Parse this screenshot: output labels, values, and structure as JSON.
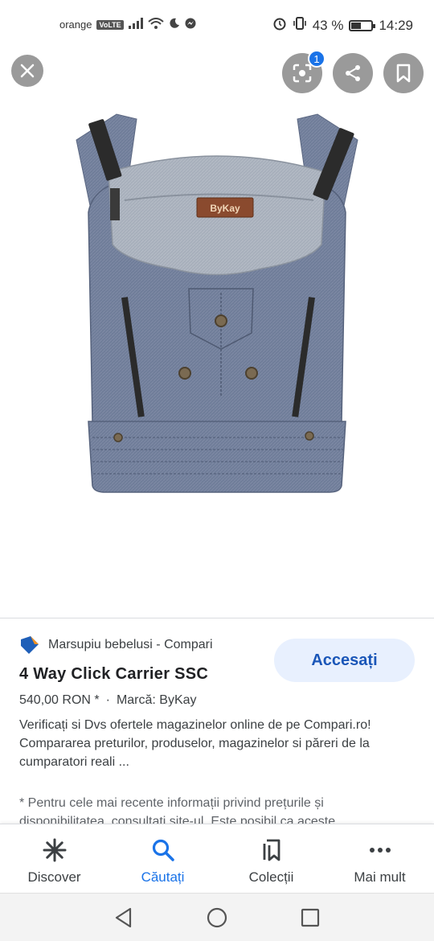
{
  "status_bar": {
    "carrier": "orange",
    "volte": "VoLTE",
    "battery_percent": "43 %",
    "battery_level": 0.43,
    "time": "14:29"
  },
  "image_viewer": {
    "lens_badge_count": "1",
    "product_brand_label": "ByKay",
    "colors": {
      "denim": "#6b7a96",
      "light_denim": "#a5adb8",
      "strap": "#2b2b2b"
    }
  },
  "result": {
    "source": "Marsupiu bebelusi - Compari",
    "access_button": "Accesați",
    "title": "4 Way Click Carrier SSC",
    "price": "540,00 RON *",
    "separator": "·",
    "brand": "Marcă: ByKay",
    "description": "Verificați si Dvs ofertele magazinelor online de pe Compari.ro! Compararea preturilor, produselor, magazinelor si păreri de la cumparatori reali ...",
    "footnote": "* Pentru cele mai recente informații privind prețurile și disponibilitatea, consultați site-ul. Este posibil ca aceste"
  },
  "bottom_nav": {
    "items": [
      {
        "label": "Discover",
        "icon": "asterisk-icon"
      },
      {
        "label": "Căutați",
        "icon": "search-icon"
      },
      {
        "label": "Colecții",
        "icon": "collections-icon"
      },
      {
        "label": "Mai mult",
        "icon": "more-dots-icon"
      }
    ],
    "active_index": 1,
    "accent": "#1a73e8"
  }
}
